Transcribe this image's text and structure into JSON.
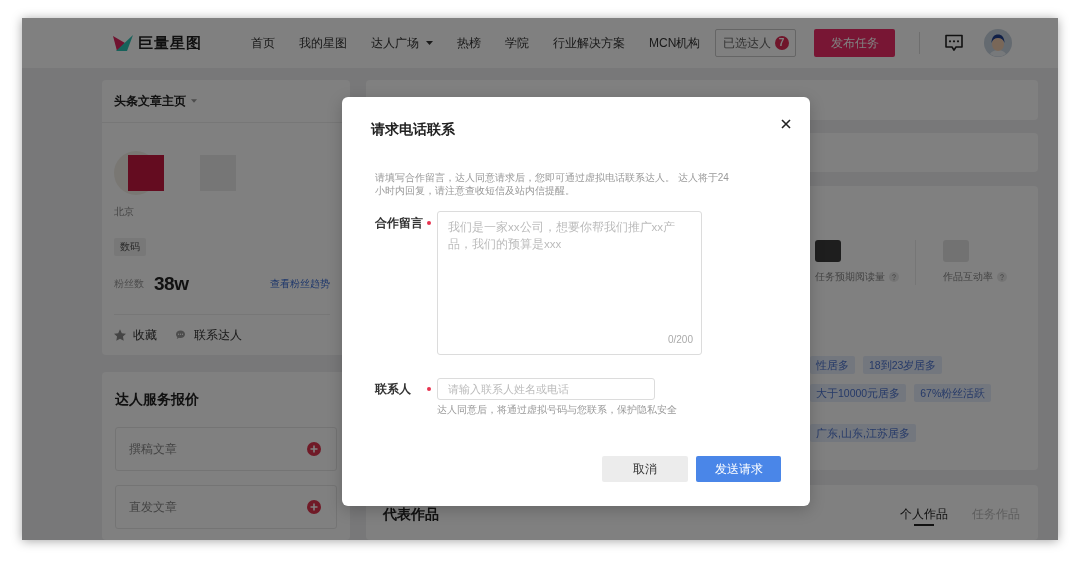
{
  "header": {
    "logo_text": "巨量星图",
    "nav": [
      {
        "label": "首页",
        "dropdown": false
      },
      {
        "label": "我的星图",
        "dropdown": false
      },
      {
        "label": "达人广场",
        "dropdown": true
      },
      {
        "label": "热榜",
        "dropdown": false
      },
      {
        "label": "学院",
        "dropdown": false
      },
      {
        "label": "行业解决方案",
        "dropdown": false
      },
      {
        "label": "MCN机构",
        "dropdown": false
      }
    ],
    "picked_button": {
      "label": "已选达人",
      "badge": "7"
    },
    "publish_button": "发布任务"
  },
  "profile": {
    "title": "头条文章主页",
    "location": "北京",
    "tag": "数码",
    "followers_label": "粉丝数",
    "followers": "38w",
    "trend_link": "查看粉丝趋势",
    "actions": [
      {
        "label": "收藏",
        "kind": "star"
      },
      {
        "label": "联系达人",
        "kind": "chat"
      }
    ]
  },
  "pricing": {
    "title": "达人服务报价",
    "items": [
      {
        "label": "撰稿文章"
      },
      {
        "label": "直发文章"
      }
    ]
  },
  "stats": [
    {
      "label": "任务预期阅读量"
    },
    {
      "label": "作品互动率"
    }
  ],
  "audience_tags": [
    {
      "tags": [
        "性居多",
        "18到23岁居多"
      ]
    },
    {
      "tags": [
        "大于10000元居多",
        "67%粉丝活跃"
      ]
    },
    {
      "tags": [
        "广东,山东,江苏居多"
      ]
    }
  ],
  "works": {
    "title": "代表作品",
    "tabs": [
      {
        "label": "个人作品",
        "selected": true
      },
      {
        "label": "任务作品",
        "selected": false
      }
    ]
  },
  "dialog": {
    "title": "请求电话联系",
    "notice": "请填写合作留言，达人同意请求后，您即可通过虚拟电话联系达人。 达人将于24小时内回复，请注意查收短信及站内信提醒。",
    "fields": [
      {
        "label": "合作留言",
        "required": true,
        "kind": "textarea",
        "placeholder": "我们是一家xx公司，想要你帮我们推广xx产品，我们的预算是xxx",
        "counter": "0/200"
      },
      {
        "label": "联系人",
        "required": true,
        "kind": "input",
        "placeholder": "请输入联系人姓名或电话",
        "hint": "达人同意后，将通过虚拟号码与您联系，保护隐私安全"
      }
    ],
    "buttons": [
      {
        "label": "取消",
        "kind": "secondary"
      },
      {
        "label": "发送请求",
        "kind": "primary"
      }
    ]
  }
}
